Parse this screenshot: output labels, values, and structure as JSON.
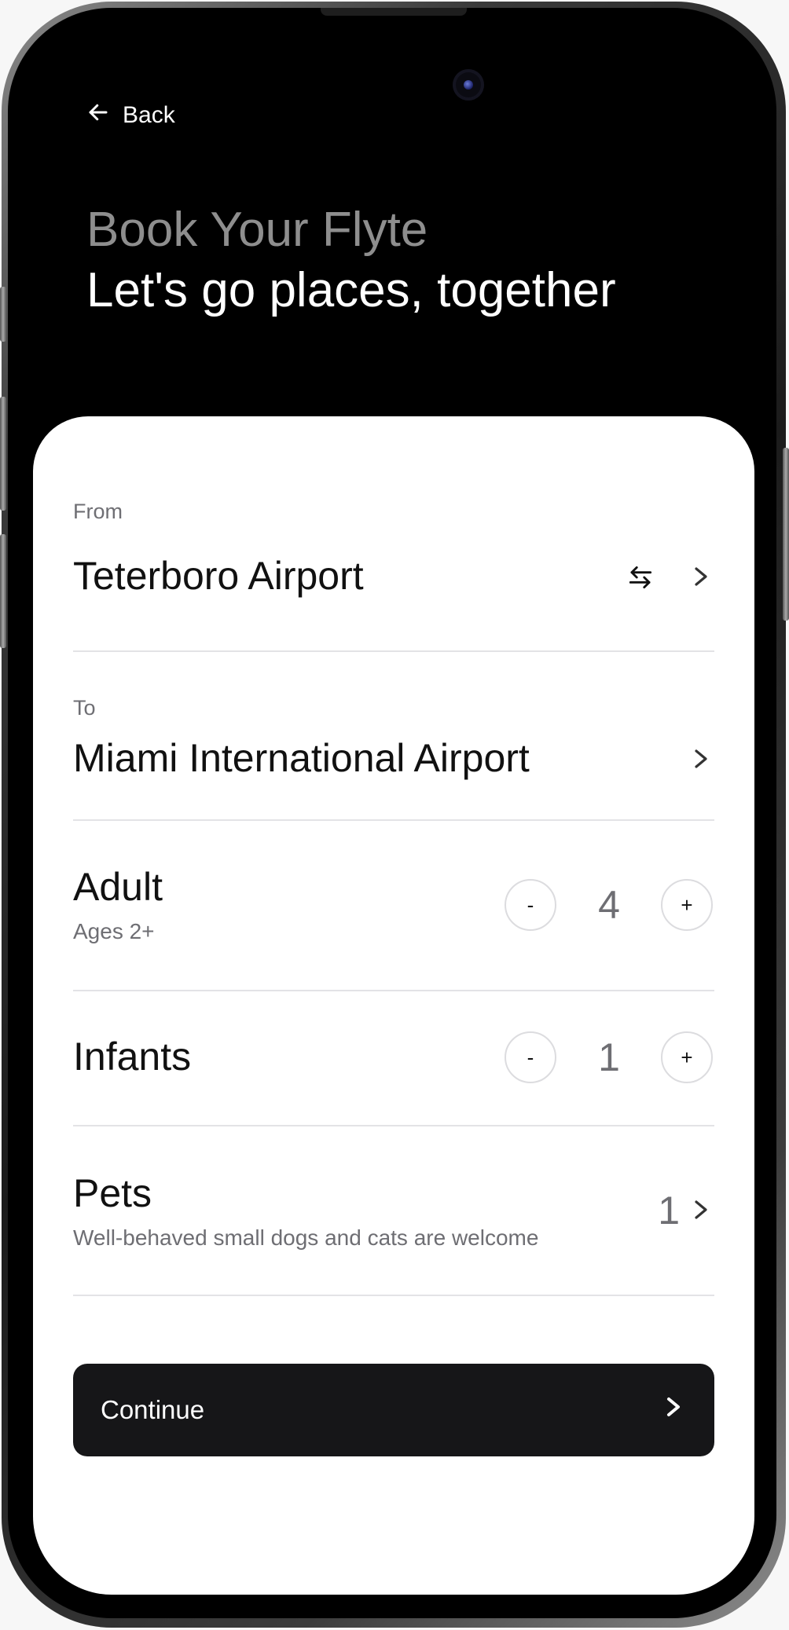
{
  "header": {
    "back_label": "Back",
    "title": "Book Your Flyte",
    "subtitle": "Let's go places, together"
  },
  "route": {
    "from_label": "From",
    "from_value": "Teterboro Airport",
    "to_label": "To",
    "to_value": "Miami International Airport"
  },
  "passengers": {
    "adult_label": "Adult",
    "adult_desc": "Ages 2+",
    "adult_count": "4",
    "infants_label": "Infants",
    "infants_count": "1",
    "decrement_label": "-",
    "increment_label": "+"
  },
  "pets": {
    "label": "Pets",
    "desc": "Well-behaved small dogs and cats are welcome",
    "count": "1"
  },
  "actions": {
    "continue_label": "Continue"
  },
  "icons": {
    "back": "arrow-left-icon",
    "swap": "swap-arrows-icon",
    "chevron": "chevron-right-icon"
  },
  "colors": {
    "screen_background": "#000000",
    "card_background": "#ffffff",
    "title_gray": "#8e8e8e",
    "button_background": "#161618",
    "muted_text": "#6e6e73"
  }
}
